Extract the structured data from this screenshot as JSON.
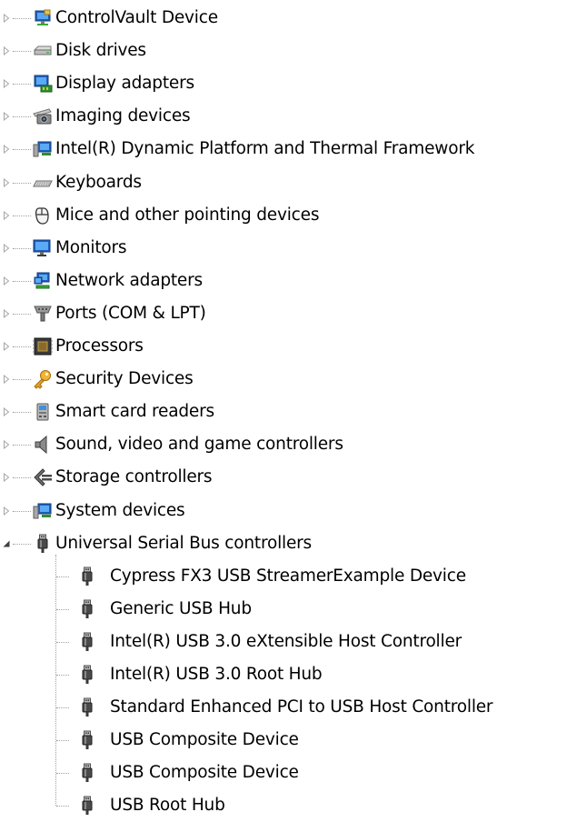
{
  "categories": [
    {
      "label": "ControlVault Device",
      "icon": "controlvault-icon",
      "expanded": false
    },
    {
      "label": "Disk drives",
      "icon": "disk-drive-icon",
      "expanded": false
    },
    {
      "label": "Display adapters",
      "icon": "display-adapter-icon",
      "expanded": false
    },
    {
      "label": "Imaging devices",
      "icon": "camera-icon",
      "expanded": false
    },
    {
      "label": "Intel(R) Dynamic Platform and Thermal Framework",
      "icon": "system-device-icon",
      "expanded": false
    },
    {
      "label": "Keyboards",
      "icon": "keyboard-icon",
      "expanded": false
    },
    {
      "label": "Mice and other pointing devices",
      "icon": "mouse-icon",
      "expanded": false
    },
    {
      "label": "Monitors",
      "icon": "monitor-icon",
      "expanded": false
    },
    {
      "label": "Network adapters",
      "icon": "network-adapter-icon",
      "expanded": false
    },
    {
      "label": "Ports (COM & LPT)",
      "icon": "port-icon",
      "expanded": false
    },
    {
      "label": "Processors",
      "icon": "processor-icon",
      "expanded": false
    },
    {
      "label": "Security Devices",
      "icon": "key-icon",
      "expanded": false
    },
    {
      "label": "Smart card readers",
      "icon": "smart-card-reader-icon",
      "expanded": false
    },
    {
      "label": "Sound, video and game controllers",
      "icon": "speaker-icon",
      "expanded": false
    },
    {
      "label": "Storage controllers",
      "icon": "storage-controller-icon",
      "expanded": false
    },
    {
      "label": "System devices",
      "icon": "system-device-icon",
      "expanded": false
    },
    {
      "label": "Universal Serial Bus controllers",
      "icon": "usb-plug-icon",
      "expanded": true
    }
  ],
  "usb_children": [
    {
      "label": "Cypress FX3 USB StreamerExample Device",
      "icon": "usb-plug-icon"
    },
    {
      "label": "Generic USB Hub",
      "icon": "usb-plug-icon"
    },
    {
      "label": "Intel(R) USB 3.0 eXtensible Host Controller",
      "icon": "usb-plug-icon"
    },
    {
      "label": "Intel(R) USB 3.0 Root Hub",
      "icon": "usb-plug-icon"
    },
    {
      "label": "Standard Enhanced PCI to USB Host Controller",
      "icon": "usb-plug-icon"
    },
    {
      "label": "USB Composite Device",
      "icon": "usb-plug-icon"
    },
    {
      "label": "USB Composite Device",
      "icon": "usb-plug-icon"
    },
    {
      "label": "USB Root Hub",
      "icon": "usb-plug-icon"
    }
  ],
  "colors": {
    "background": "#ffffff",
    "text": "#000000",
    "tree_line": "#a0a0a0",
    "expander_collapsed": "#a6a6a6",
    "expander_expanded": "#404040"
  }
}
